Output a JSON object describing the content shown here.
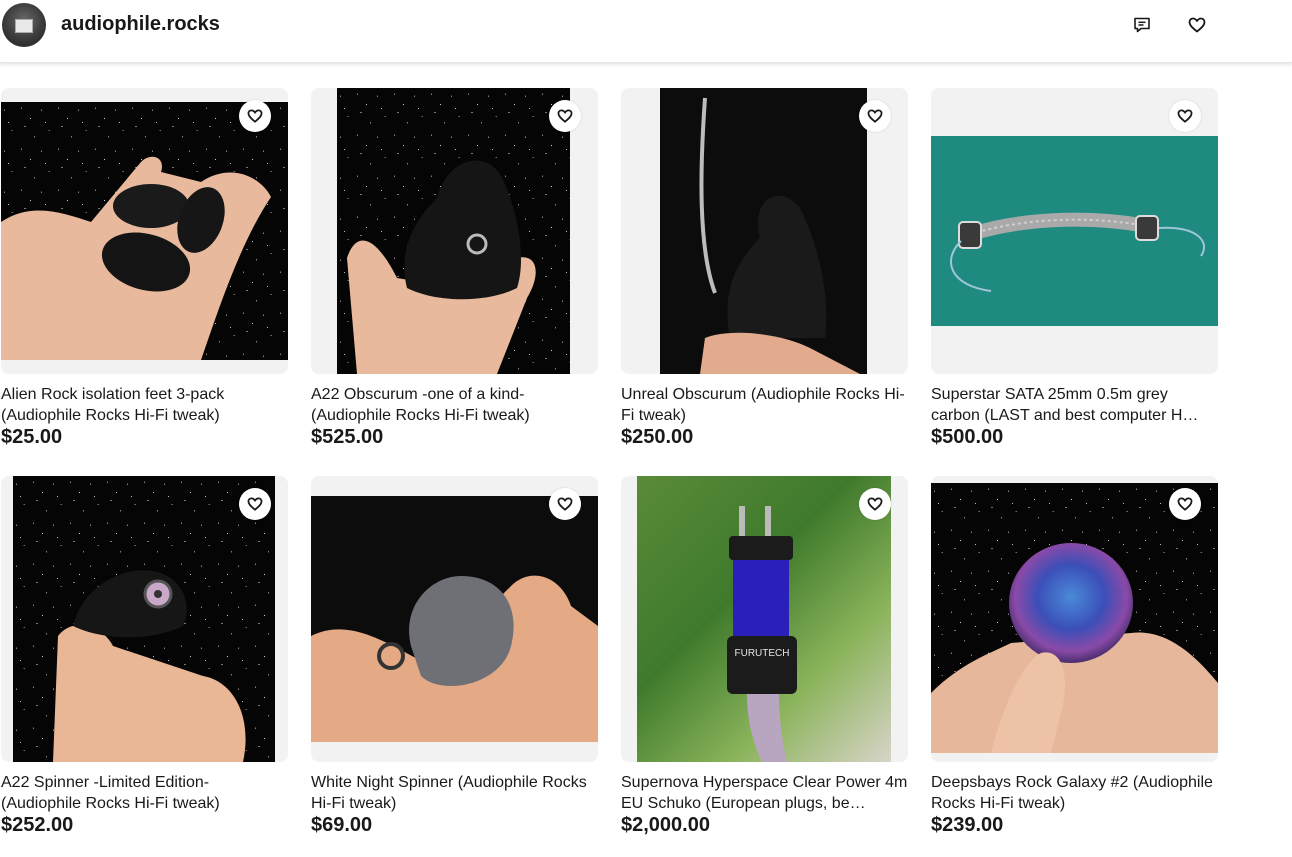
{
  "store": {
    "name": "audiophile.rocks",
    "icons": {
      "messages": "message-icon",
      "favorite": "heart-icon"
    }
  },
  "listings": [
    {
      "title": "Alien Rock isolation feet 3-pack (Audiophile Rocks Hi-Fi tweak)",
      "price": "$25.00"
    },
    {
      "title": "A22 Obscurum -one of a kind- (Audiophile Rocks Hi-Fi tweak)",
      "price": "$525.00"
    },
    {
      "title": "Unreal Obscurum (Audiophile Rocks Hi-Fi tweak)",
      "price": "$250.00"
    },
    {
      "title": "Superstar SATA 25mm 0.5m grey carbon (LAST and best computer H…",
      "price": "$500.00"
    },
    {
      "title": "A22 Spinner -Limited Edition- (Audiophile Rocks Hi-Fi tweak)",
      "price": "$252.00"
    },
    {
      "title": "White Night Spinner (Audiophile Rocks Hi-Fi tweak)",
      "price": "$69.00"
    },
    {
      "title": "Supernova Hyperspace Clear Power 4m EU Schuko (European plugs, be…",
      "price": "$2,000.00"
    },
    {
      "title": "Deepsbays Rock Galaxy #2 (Audiophile Rocks Hi-Fi tweak)",
      "price": "$239.00"
    }
  ],
  "photo_text": {
    "plug_brand": "FURUTECH"
  },
  "colors": {
    "text": "#191919",
    "image_bg": "#f2f2f2",
    "teal_photo": "#1e8a80"
  }
}
